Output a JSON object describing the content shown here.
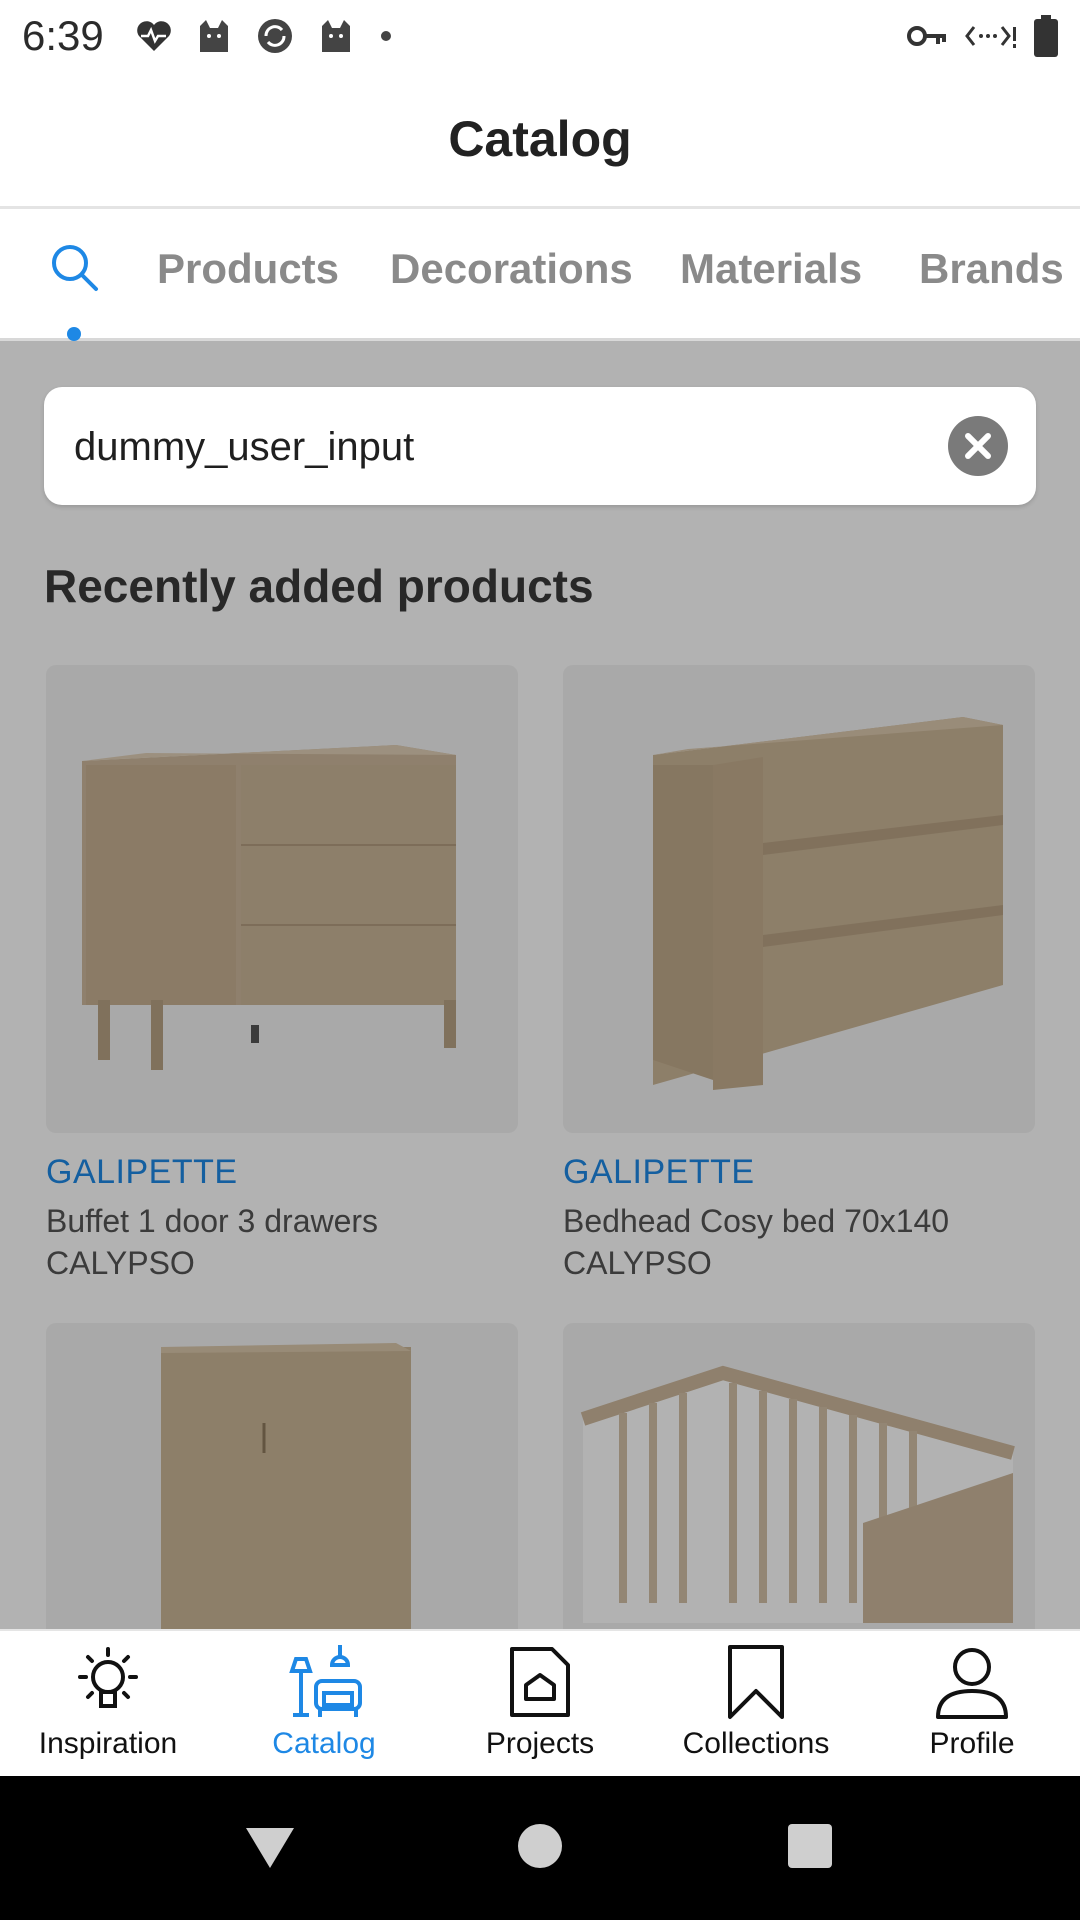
{
  "status_bar": {
    "time": "6:39",
    "left_icons": [
      "heart-pulse-icon",
      "cat-icon",
      "sync-badge-icon",
      "cat-icon",
      "dot-icon"
    ],
    "right_icons": [
      "vpn-key-icon",
      "data-transfer-icon",
      "battery-icon"
    ]
  },
  "app_bar": {
    "title": "Catalog"
  },
  "tabs": {
    "search_icon": "search-icon",
    "items": [
      {
        "label": "Products"
      },
      {
        "label": "Decorations"
      },
      {
        "label": "Materials"
      },
      {
        "label": "Brands"
      }
    ],
    "active": "search"
  },
  "search": {
    "value": "dummy_user_input"
  },
  "section": {
    "title": "Recently added products"
  },
  "products": [
    {
      "brand": "GALIPETTE",
      "name": "Buffet 1 door 3 drawers CALYPSO",
      "image": "buffet-image"
    },
    {
      "brand": "GALIPETTE",
      "name": "Bedhead Cosy bed 70x140 CALYPSO",
      "image": "bedhead-image"
    },
    {
      "brand": "",
      "name": "",
      "image": "wardrobe-image"
    },
    {
      "brand": "",
      "name": "",
      "image": "crib-image"
    }
  ],
  "bottom_nav": {
    "items": [
      {
        "label": "Inspiration",
        "icon": "lightbulb-icon"
      },
      {
        "label": "Catalog",
        "icon": "lamp-sofa-icon",
        "active": true
      },
      {
        "label": "Projects",
        "icon": "document-house-icon"
      },
      {
        "label": "Collections",
        "icon": "bookmark-icon"
      },
      {
        "label": "Profile",
        "icon": "person-icon"
      }
    ]
  },
  "colors": {
    "accent": "#1e88e5",
    "wood": "#c8b59a",
    "overlay": "rgba(0,0,0,0.30)"
  }
}
